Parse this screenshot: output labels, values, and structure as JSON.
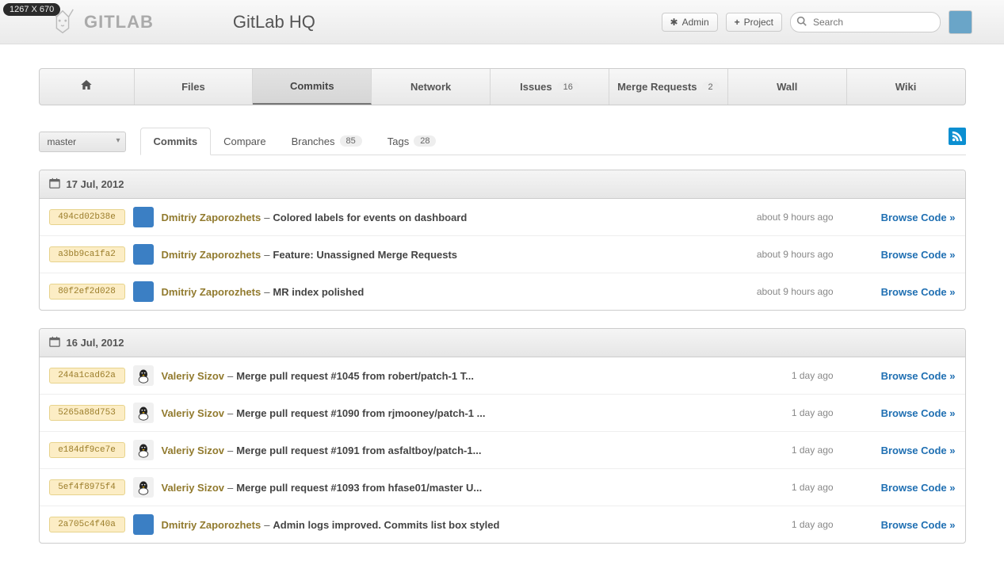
{
  "dimensions": "1267 X 670",
  "header": {
    "logo_text": "GITLAB",
    "project_title": "GitLab HQ",
    "admin_label": "Admin",
    "project_btn_label": "Project",
    "search_placeholder": "Search"
  },
  "nav": {
    "files": "Files",
    "commits": "Commits",
    "network": "Network",
    "issues": "Issues",
    "issues_count": "16",
    "merge_requests": "Merge Requests",
    "merge_requests_count": "2",
    "wall": "Wall",
    "wiki": "Wiki"
  },
  "subbar": {
    "branch": "master",
    "commits": "Commits",
    "compare": "Compare",
    "branches": "Branches",
    "branches_count": "85",
    "tags": "Tags",
    "tags_count": "28"
  },
  "labels": {
    "browse": "Browse Code »",
    "sep": "–"
  },
  "groups": [
    {
      "date": "17 Jul, 2012",
      "commits": [
        {
          "sha": "494cd02b38e",
          "author": "Dmitriy Zaporozhets",
          "message": "Colored labels for events on dashboard",
          "time": "about 9 hours ago",
          "avatar": "blue"
        },
        {
          "sha": "a3bb9ca1fa2",
          "author": "Dmitriy Zaporozhets",
          "message": "Feature: Unassigned Merge Requests",
          "time": "about 9 hours ago",
          "avatar": "blue"
        },
        {
          "sha": "80f2ef2d028",
          "author": "Dmitriy Zaporozhets",
          "message": "MR index polished",
          "time": "about 9 hours ago",
          "avatar": "blue"
        }
      ]
    },
    {
      "date": "16 Jul, 2012",
      "commits": [
        {
          "sha": "244a1cad62a",
          "author": "Valeriy Sizov",
          "message": "Merge pull request #1045 from robert/patch-1 T...",
          "time": "1 day ago",
          "avatar": "tux"
        },
        {
          "sha": "5265a88d753",
          "author": "Valeriy Sizov",
          "message": "Merge pull request #1090 from rjmooney/patch-1 ...",
          "time": "1 day ago",
          "avatar": "tux"
        },
        {
          "sha": "e184df9ce7e",
          "author": "Valeriy Sizov",
          "message": "Merge pull request #1091 from asfaltboy/patch-1...",
          "time": "1 day ago",
          "avatar": "tux"
        },
        {
          "sha": "5ef4f8975f4",
          "author": "Valeriy Sizov",
          "message": "Merge pull request #1093 from hfase01/master U...",
          "time": "1 day ago",
          "avatar": "tux"
        },
        {
          "sha": "2a705c4f40a",
          "author": "Dmitriy Zaporozhets",
          "message": "Admin logs improved. Commits list box styled",
          "time": "1 day ago",
          "avatar": "blue"
        }
      ]
    }
  ]
}
